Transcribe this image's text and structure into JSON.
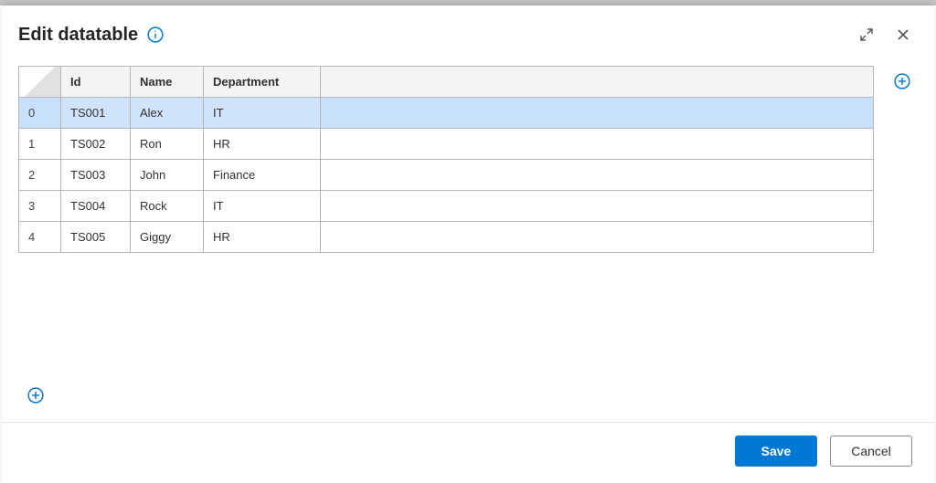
{
  "dialog": {
    "title": "Edit datatable"
  },
  "table": {
    "columns": [
      "Id",
      "Name",
      "Department"
    ],
    "rows": [
      {
        "index": "0",
        "id": "TS001",
        "name": "Alex",
        "department": "IT",
        "selected": true
      },
      {
        "index": "1",
        "id": "TS002",
        "name": "Ron",
        "department": "HR",
        "selected": false
      },
      {
        "index": "2",
        "id": "TS003",
        "name": "John",
        "department": "Finance",
        "selected": false
      },
      {
        "index": "3",
        "id": "TS004",
        "name": "Rock",
        "department": "IT",
        "selected": false
      },
      {
        "index": "4",
        "id": "TS005",
        "name": "Giggy",
        "department": "HR",
        "selected": false
      }
    ]
  },
  "footer": {
    "save": "Save",
    "cancel": "Cancel"
  },
  "icons": {
    "info": "info-icon",
    "expand": "expand-icon",
    "close": "close-icon",
    "addColumn": "plus-circle-icon",
    "addRow": "plus-circle-icon"
  }
}
